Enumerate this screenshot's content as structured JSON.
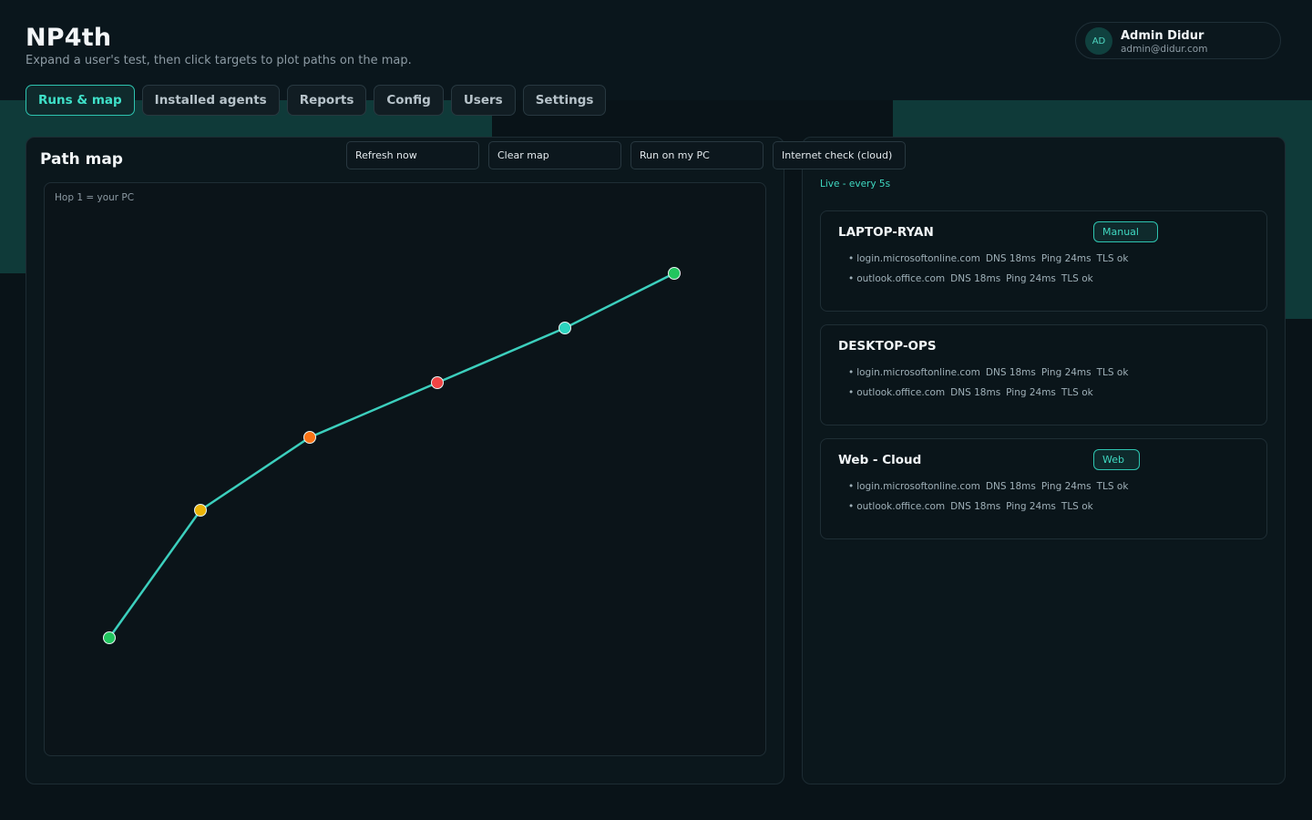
{
  "app": {
    "title": "NP4th",
    "subtitle": "Expand a user's test, then click targets to plot paths on the map."
  },
  "user": {
    "initials": "AD",
    "name": "Admin Didur",
    "email": "admin@didur.com"
  },
  "tabs": [
    {
      "label": "Runs & map",
      "active": true
    },
    {
      "label": "Installed agents",
      "active": false
    },
    {
      "label": "Reports",
      "active": false
    },
    {
      "label": "Config",
      "active": false
    },
    {
      "label": "Users",
      "active": false
    },
    {
      "label": "Settings",
      "active": false
    }
  ],
  "toolbar": {
    "refresh_label": "Refresh now",
    "clear_label": "Clear map",
    "run_label": "Run on my PC",
    "internet_label": "Internet check (cloud)"
  },
  "map": {
    "title": "Path map",
    "hint": "Hop 1 = your PC",
    "line_color": "#3ccfbd",
    "hops": [
      {
        "hop": 1,
        "color": "#22c55e"
      },
      {
        "hop": 2,
        "color": "#eab308"
      },
      {
        "hop": 3,
        "color": "#f97316"
      },
      {
        "hop": 4,
        "color": "#ef4444"
      },
      {
        "hop": 5,
        "color": "#2dd4bf"
      },
      {
        "hop": 6,
        "color": "#22c55e"
      }
    ]
  },
  "status": {
    "live_label": "Live - every 5s"
  },
  "agents": [
    {
      "name": "LAPTOP-RYAN",
      "badge": "Manual",
      "targets": [
        {
          "host": "login.microsoftonline.com",
          "dns": "DNS 18ms",
          "ping": "Ping 24ms",
          "tls": "TLS ok"
        },
        {
          "host": "outlook.office.com",
          "dns": "DNS 18ms",
          "ping": "Ping 24ms",
          "tls": "TLS ok"
        }
      ]
    },
    {
      "name": "DESKTOP-OPS",
      "badge": "",
      "targets": [
        {
          "host": "login.microsoftonline.com",
          "dns": "DNS 18ms",
          "ping": "Ping 24ms",
          "tls": "TLS ok"
        },
        {
          "host": "outlook.office.com",
          "dns": "DNS 18ms",
          "ping": "Ping 24ms",
          "tls": "TLS ok"
        }
      ]
    },
    {
      "name": "Web - Cloud",
      "badge": "Web",
      "targets": [
        {
          "host": "login.microsoftonline.com",
          "dns": "DNS 18ms",
          "ping": "Ping 24ms",
          "tls": "TLS ok"
        },
        {
          "host": "outlook.office.com",
          "dns": "DNS 18ms",
          "ping": "Ping 24ms",
          "tls": "TLS ok"
        }
      ]
    }
  ],
  "icons": {
    "bullet": "•"
  }
}
